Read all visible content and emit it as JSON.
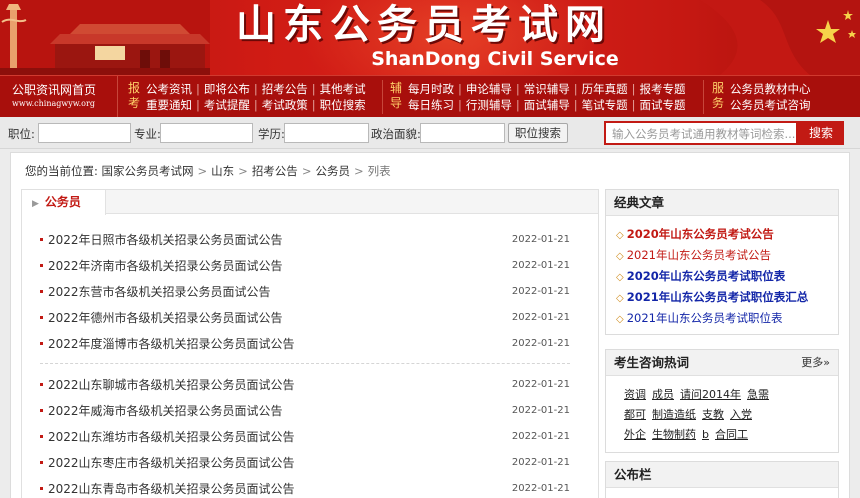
{
  "banner": {
    "title": "山东公务员考试网",
    "subtitle": "ShanDong Civil Service"
  },
  "nav": {
    "home_label": "公职资讯网首页",
    "home_url": "www.chinagwyw.org",
    "groups": [
      {
        "label": "报考",
        "rows": [
          [
            "公考资讯",
            "即将公布",
            "招考公告",
            "其他考试"
          ],
          [
            "重要通知",
            "考试提醒",
            "考试政策",
            "职位搜索"
          ]
        ]
      },
      {
        "label": "辅导",
        "rows": [
          [
            "每月时政",
            "申论辅导",
            "常识辅导",
            "历年真题",
            "报考专题"
          ],
          [
            "每日练习",
            "行测辅导",
            "面试辅导",
            "笔试专题",
            "面试专题"
          ]
        ]
      },
      {
        "label": "服务",
        "rows": [
          [
            "公务员教材中心"
          ],
          [
            "公务员考试咨询"
          ]
        ]
      }
    ]
  },
  "search": {
    "position_label": "职位:",
    "major_label": "专业:",
    "education_label": "学历:",
    "political_label": "政治面貌:",
    "search_button": "职位搜索",
    "keyword_placeholder": "输入公务员考试通用教材等词检索...",
    "keyword_button": "搜索"
  },
  "breadcrumb": {
    "prefix": "您的当前位置:",
    "items": [
      "国家公务员考试网",
      "山东",
      "招考公告",
      "公务员"
    ],
    "last": "列表"
  },
  "list": {
    "tab_label": "公务员",
    "items": [
      {
        "title": "2022年日照市各级机关招录公务员面试公告",
        "date": "2022-01-21"
      },
      {
        "title": "2022年济南市各级机关招录公务员面试公告",
        "date": "2022-01-21"
      },
      {
        "title": "2022东营市各级机关招录公务员面试公告",
        "date": "2022-01-21"
      },
      {
        "title": "2022年德州市各级机关招录公务员面试公告",
        "date": "2022-01-21"
      },
      {
        "title": "2022年度淄博市各级机关招录公务员面试公告",
        "date": "2022-01-21"
      },
      {
        "title": "2022山东聊城市各级机关招录公务员面试公告",
        "date": "2022-01-21"
      },
      {
        "title": "2022年威海市各级机关招录公务员面试公告",
        "date": "2022-01-21"
      },
      {
        "title": "2022山东潍坊市各级机关招录公务员面试公告",
        "date": "2022-01-21"
      },
      {
        "title": "2022山东枣庄市各级机关招录公务员面试公告",
        "date": "2022-01-21"
      },
      {
        "title": "2022山东青岛市各级机关招录公务员面试公告",
        "date": "2022-01-21"
      }
    ]
  },
  "classic": {
    "title": "经典文章",
    "items": [
      {
        "text": "2020年山东公务员考试公告",
        "style": "red"
      },
      {
        "text": "2021年山东公务员考试公告",
        "style": "red2"
      },
      {
        "text": "2020年山东公务员考试职位表",
        "style": "blue"
      },
      {
        "text": "2021年山东公务员考试职位表汇总",
        "style": "blue"
      },
      {
        "text": "2021年山东公务员考试职位表",
        "style": "blue2"
      }
    ]
  },
  "hot": {
    "title": "考生咨询热词",
    "more": "更多»",
    "rows": [
      [
        "资调",
        "成员",
        "请问2014年",
        "急需"
      ],
      [
        "都可",
        "制造造纸",
        "支教",
        "入党"
      ],
      [
        "外企",
        "生物制药",
        "b",
        "合同工"
      ]
    ]
  },
  "notice": {
    "title": "公布栏"
  }
}
